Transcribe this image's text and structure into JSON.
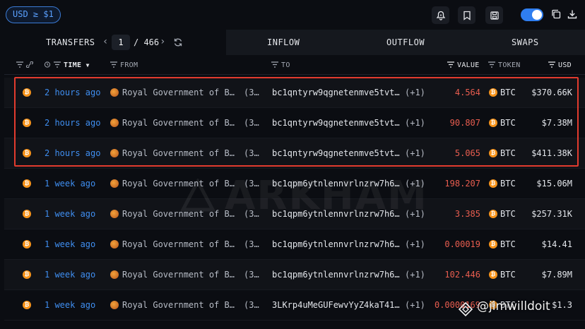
{
  "top": {
    "filter_pill": "USD ≥ $1"
  },
  "tabs": {
    "transfers": "TRANSFERS",
    "current_page": "1",
    "total_pages": "/ 466",
    "inflow": "INFLOW",
    "outflow": "OUTFLOW",
    "swaps": "SWAPS"
  },
  "columns": {
    "time": "TIME",
    "from": "FROM",
    "to": "TO",
    "value": "VALUE",
    "token": "TOKEN",
    "usd": "USD"
  },
  "rows": [
    {
      "time": "2 hours ago",
      "from": "Royal Government of B…",
      "from_count": "(3…",
      "to": "bc1qntyrw9qgnetenmve5tvt…",
      "to_extra": "(+1)",
      "value": "4.564",
      "token": "BTC",
      "usd": "$370.66K"
    },
    {
      "time": "2 hours ago",
      "from": "Royal Government of B…",
      "from_count": "(3…",
      "to": "bc1qntyrw9qgnetenmve5tvt…",
      "to_extra": "(+1)",
      "value": "90.807",
      "token": "BTC",
      "usd": "$7.38M"
    },
    {
      "time": "2 hours ago",
      "from": "Royal Government of B…",
      "from_count": "(3…",
      "to": "bc1qntyrw9qgnetenmve5tvt…",
      "to_extra": "(+1)",
      "value": "5.065",
      "token": "BTC",
      "usd": "$411.38K"
    },
    {
      "time": "1 week ago",
      "from": "Royal Government of B…",
      "from_count": "(3…",
      "to": "bc1qpm6ytnlennvrlnzrw7h6…",
      "to_extra": "(+1)",
      "value": "198.207",
      "token": "BTC",
      "usd": "$15.06M"
    },
    {
      "time": "1 week ago",
      "from": "Royal Government of B…",
      "from_count": "(3…",
      "to": "bc1qpm6ytnlennvrlnzrw7h6…",
      "to_extra": "(+1)",
      "value": "3.385",
      "token": "BTC",
      "usd": "$257.31K"
    },
    {
      "time": "1 week ago",
      "from": "Royal Government of B…",
      "from_count": "(3…",
      "to": "bc1qpm6ytnlennvrlnzrw7h6…",
      "to_extra": "(+1)",
      "value": "0.00019",
      "token": "BTC",
      "usd": "$14.41"
    },
    {
      "time": "1 week ago",
      "from": "Royal Government of B…",
      "from_count": "(3…",
      "to": "bc1qpm6ytnlennvrlnzrw7h6…",
      "to_extra": "(+1)",
      "value": "102.446",
      "token": "BTC",
      "usd": "$7.89M"
    },
    {
      "time": "1 week ago",
      "from": "Royal Government of B…",
      "from_count": "(3…",
      "to": "3LKrp4uMeGUFewvYyZ4kaT41…",
      "to_extra": "(+1)",
      "value": "0.0000169",
      "token": "BTC",
      "usd": "$1.3"
    }
  ],
  "overlay": {
    "watermark": "ARKHAM",
    "credit": "@jimwilldoit"
  },
  "colors": {
    "accent": "#3f8ef0",
    "value_red": "#e85d4f",
    "btc_orange": "#f7931a",
    "highlight_red": "#e23b2e"
  }
}
